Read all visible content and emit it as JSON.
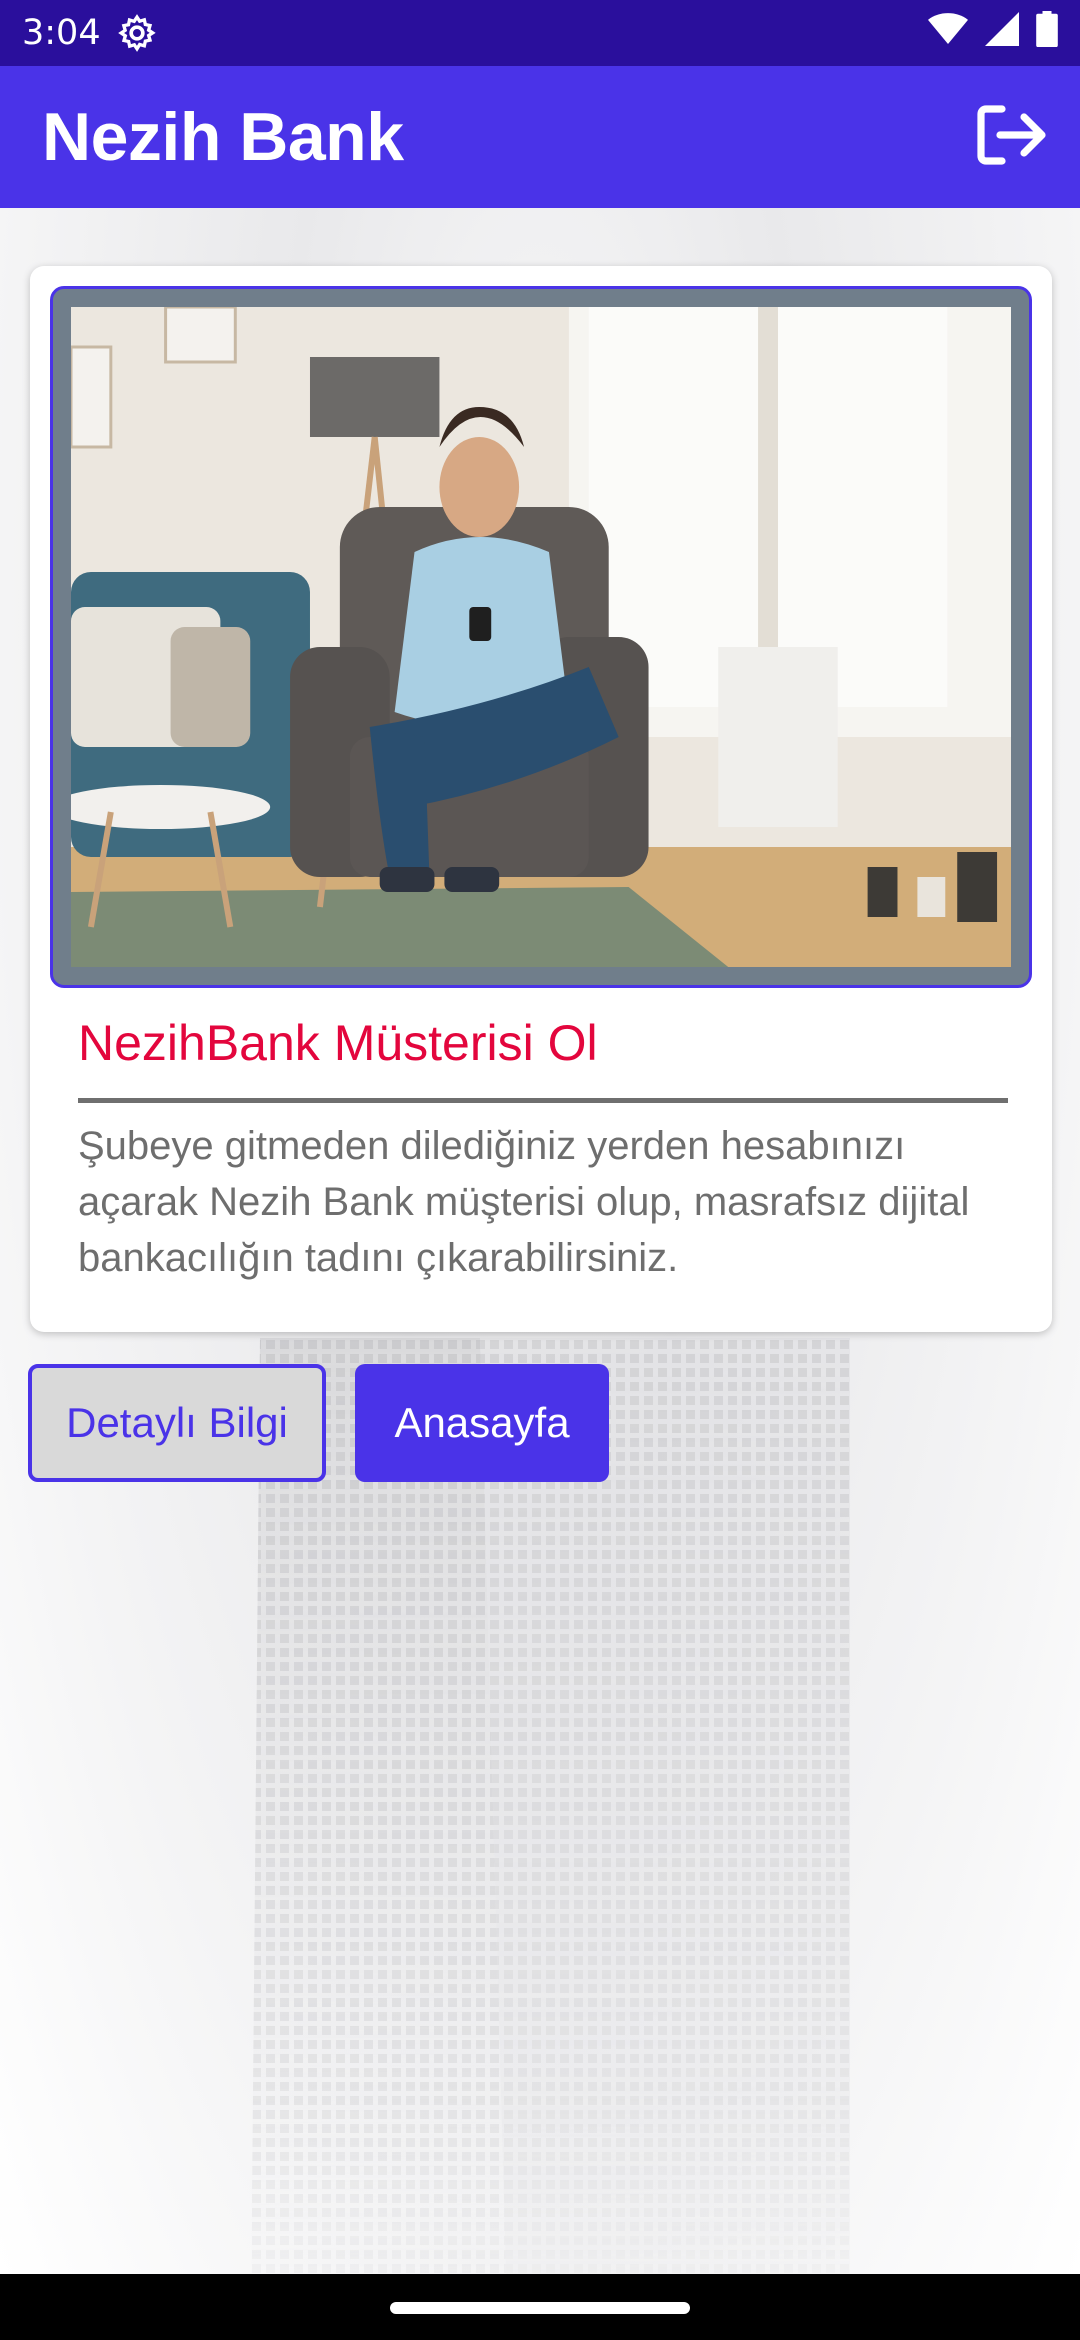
{
  "status_bar": {
    "time": "3:04",
    "icons": [
      "gear-icon",
      "wifi-icon",
      "signal-icon",
      "battery-icon"
    ]
  },
  "app_bar": {
    "title": "Nezih Bank",
    "logout_icon": "logout-icon"
  },
  "card": {
    "image_alt": "Smiling man sitting in an armchair using his phone",
    "title": "NezihBank Müsterisi Ol",
    "body": "Şubeye gitmeden dilediğiniz yerden hesabınızı açarak Nezih Bank müşterisi olup, masrafsız dijital bankacılığın tadını çıkarabilirsiniz."
  },
  "buttons": {
    "detail_label": "Detaylı Bilgi",
    "home_label": "Anasayfa"
  },
  "colors": {
    "primary": "#4a33e8",
    "status_bar": "#2a0f9c",
    "accent_title": "#e3063d",
    "body_text": "#6e6e6e"
  }
}
